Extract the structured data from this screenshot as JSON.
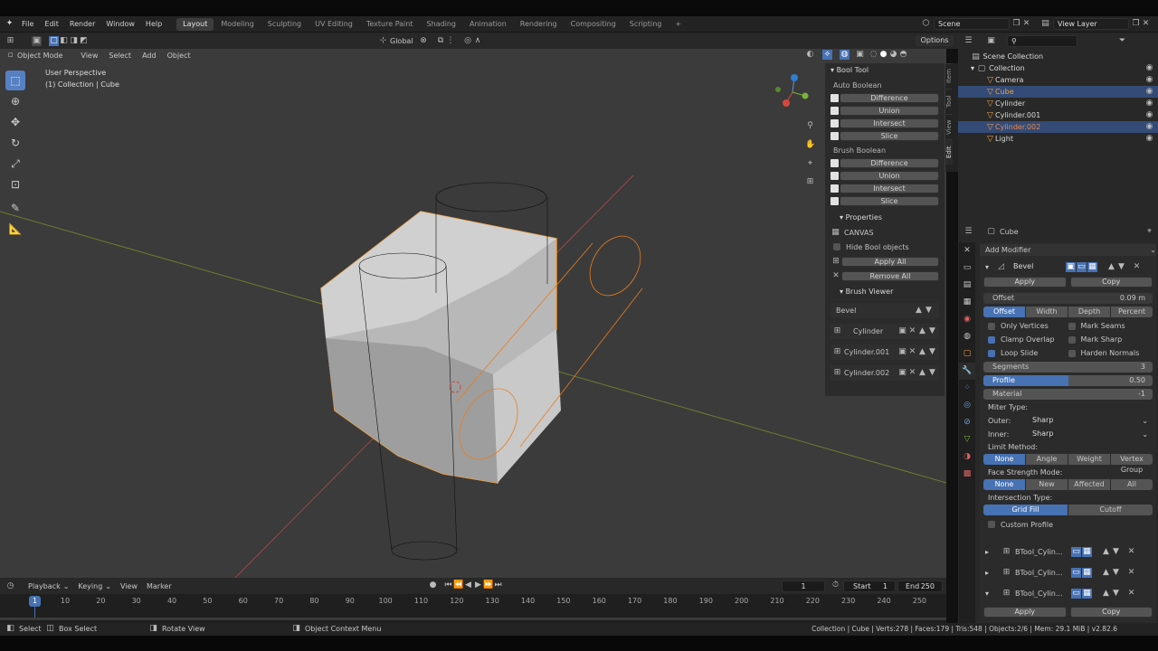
{
  "topbar": {
    "menus": [
      "File",
      "Edit",
      "Render",
      "Window",
      "Help"
    ],
    "workspaces": [
      "Layout",
      "Modeling",
      "Sculpting",
      "UV Editing",
      "Texture Paint",
      "Shading",
      "Animation",
      "Rendering",
      "Compositing",
      "Scripting"
    ],
    "add_tab": "+",
    "scene": "Scene",
    "view_layer": "View Layer"
  },
  "viewport": {
    "transform_orientation": "Global",
    "options": "Options",
    "mode": "Object Mode",
    "menus": [
      "View",
      "Select",
      "Add",
      "Object"
    ],
    "overlay_text_1": "User Perspective",
    "overlay_text_2": "(1) Collection | Cube"
  },
  "npanel": {
    "tabs": [
      "Item",
      "Tool",
      "View",
      "Edit"
    ],
    "title": "Bool Tool",
    "auto_label": "Auto Boolean",
    "auto_ops": [
      "Difference",
      "Union",
      "Intersect",
      "Slice"
    ],
    "brush_label": "Brush Boolean",
    "brush_ops": [
      "Difference",
      "Union",
      "Intersect",
      "Slice"
    ],
    "properties_label": "Properties",
    "canvas": "CANVAS",
    "hide_bool": "Hide Bool objects",
    "apply_all": "Apply All",
    "remove_all": "Remove All",
    "brush_viewer": "Brush Viewer",
    "bevel": "Bevel",
    "brushes": [
      "Cylinder",
      "Cylinder.001",
      "Cylinder.002"
    ]
  },
  "outliner": {
    "root": "Scene Collection",
    "collection": "Collection",
    "items": [
      {
        "name": "Camera",
        "selected": false,
        "color": "#d8d8d8"
      },
      {
        "name": "Cube",
        "selected": true,
        "color": "#f0a040"
      },
      {
        "name": "Cylinder",
        "selected": false,
        "color": "#d8d8d8"
      },
      {
        "name": "Cylinder.001",
        "selected": false,
        "color": "#d8d8d8"
      },
      {
        "name": "Cylinder.002",
        "selected": true,
        "color": "#e8884a"
      },
      {
        "name": "Light",
        "selected": false,
        "color": "#d8d8d8"
      }
    ]
  },
  "props": {
    "object": "Cube",
    "add_modifier": "Add Modifier",
    "modifier_name": "Bevel",
    "apply": "Apply",
    "copy": "Copy",
    "offset_label": "Offset",
    "offset_value": "0.09 m",
    "width_types": [
      "Offset",
      "Width",
      "Depth",
      "Percent"
    ],
    "only_vertices": "Only Vertices",
    "mark_seams": "Mark Seams",
    "clamp_overlap": "Clamp Overlap",
    "mark_sharp": "Mark Sharp",
    "loop_slide": "Loop Slide",
    "harden_normals": "Harden Normals",
    "segments_label": "Segments",
    "segments_value": "3",
    "profile_label": "Profile",
    "profile_value": "0.50",
    "profile_fill": 0.5,
    "material_label": "Material",
    "material_value": "-1",
    "miter_type": "Miter Type:",
    "outer_label": "Outer:",
    "outer_value": "Sharp",
    "inner_label": "Inner:",
    "inner_value": "Sharp",
    "limit_method": "Limit Method:",
    "limit_options": [
      "None",
      "Angle",
      "Weight",
      "Vertex Group"
    ],
    "face_strength": "Face Strength Mode:",
    "face_options": [
      "None",
      "New",
      "Affected",
      "All"
    ],
    "intersection_type": "Intersection Type:",
    "intersection_options": [
      "Grid Fill",
      "Cutoff"
    ],
    "custom_profile": "Custom Profile",
    "btool_mods": [
      "BTool_Cylin...",
      "BTool_Cylin...",
      "BTool_Cylin..."
    ],
    "apply2": "Apply",
    "copy2": "Copy"
  },
  "timeline": {
    "menus": [
      "Playback",
      "Keying",
      "View",
      "Marker"
    ],
    "current_frame": "1",
    "start_label": "Start",
    "start": "1",
    "end_label": "End",
    "end": "250",
    "ticks": [
      "10",
      "20",
      "30",
      "40",
      "50",
      "60",
      "70",
      "80",
      "90",
      "100",
      "110",
      "120",
      "130",
      "140",
      "150",
      "160",
      "170",
      "180",
      "190",
      "200",
      "210",
      "220",
      "230",
      "240",
      "250"
    ],
    "playhead": "1"
  },
  "status": {
    "select": "Select",
    "box_select": "Box Select",
    "rotate_view": "Rotate View",
    "context_menu": "Object Context Menu",
    "stats": "Collection | Cube | Verts:278 | Faces:179 | Tris:548 | Objects:2/6 | Mem: 29.1 MiB | v2.82.6"
  },
  "colors": {
    "accent": "#4772b3",
    "selected_orange": "#f0a040",
    "bg_panel": "#282828",
    "viewport": "#3b3b3b"
  }
}
